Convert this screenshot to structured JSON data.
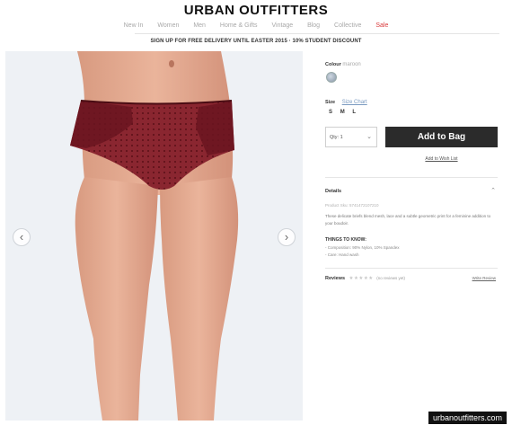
{
  "brand": {
    "name": "URBAN OUTFITTERS"
  },
  "nav": {
    "items": [
      {
        "label": "New In"
      },
      {
        "label": "Women"
      },
      {
        "label": "Men"
      },
      {
        "label": "Home & Gifts"
      },
      {
        "label": "Vintage"
      },
      {
        "label": "Blog"
      },
      {
        "label": "Collective"
      },
      {
        "label": "Sale",
        "accent": "#d9383a"
      }
    ]
  },
  "promo": {
    "text": "SIGN UP FOR FREE DELIVERY UNTIL EASTER 2015 · 10% STUDENT DISCOUNT"
  },
  "gallery": {
    "prev_icon": "chevron-left-icon",
    "prev_glyph": "‹",
    "next_icon": "chevron-right-icon",
    "next_glyph": "›"
  },
  "product": {
    "colour_label": "Colour",
    "colour_value": "maroon",
    "size_label": "Size",
    "size_chart_label": "Size Chart",
    "sizes": [
      "S",
      "M",
      "L"
    ],
    "qty_label": "Qty: 1",
    "add_to_bag_label": "Add to Bag",
    "wish_list_label": "Add to Wish List"
  },
  "details": {
    "heading": "Details",
    "sku": "Product Sku: 5741472107210",
    "description": "These delicate briefs blend mesh, lace and a subtle geometric print for a feminine addition to your boudoir.",
    "things_heading": "THINGS TO KNOW:",
    "things": [
      "- Composition: 90% Nylon, 10% Spandex",
      "- Care: Hand wash"
    ]
  },
  "reviews": {
    "label": "Reviews",
    "stars": "★★★★★",
    "count_text": "(no reviews yet)",
    "write_label": "Write Review"
  },
  "watermark": {
    "text": "urbanoutfitters.com"
  },
  "colors": {
    "accent": "#d9383a",
    "button_bg": "#2b2b2b",
    "garment": "#7a1a22"
  }
}
